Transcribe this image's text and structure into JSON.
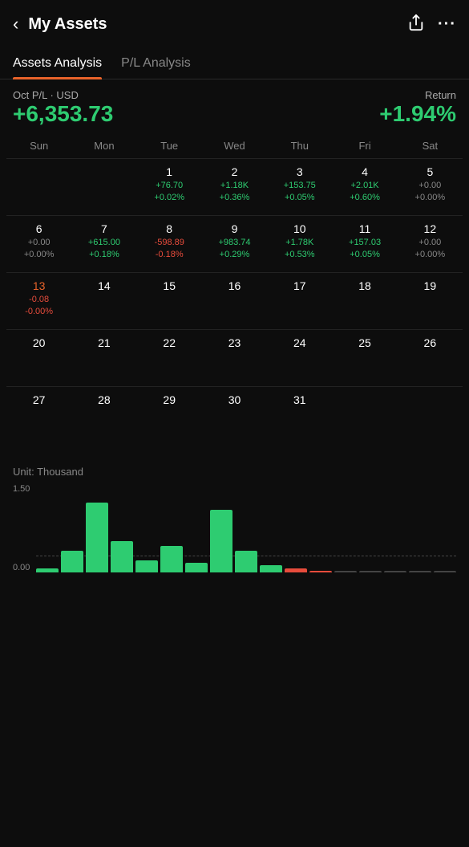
{
  "header": {
    "title": "My Assets",
    "back_icon": "‹",
    "share_icon": "⬆",
    "more_icon": "···"
  },
  "tabs": [
    {
      "label": "Assets Analysis",
      "active": true
    },
    {
      "label": "P/L Analysis",
      "active": false
    }
  ],
  "summary": {
    "period_label": "Oct P/L · USD",
    "period_value": "+6,353.73",
    "return_label": "Return",
    "return_value": "+1.94%"
  },
  "calendar": {
    "day_names": [
      "Sun",
      "Mon",
      "Tue",
      "Wed",
      "Thu",
      "Fri",
      "Sat"
    ],
    "weeks": [
      {
        "cells": [
          {
            "day": "",
            "amount": "",
            "pct": "",
            "color": "empty"
          },
          {
            "day": "",
            "amount": "",
            "pct": "",
            "color": "empty"
          },
          {
            "day": "1",
            "amount": "+76.70",
            "pct": "+0.02%",
            "color": "green"
          },
          {
            "day": "2",
            "amount": "+1.18K",
            "pct": "+0.36%",
            "color": "green"
          },
          {
            "day": "3",
            "amount": "+153.75",
            "pct": "+0.05%",
            "color": "green"
          },
          {
            "day": "4",
            "amount": "+2.01K",
            "pct": "+0.60%",
            "color": "green"
          },
          {
            "day": "5",
            "amount": "+0.00",
            "pct": "+0.00%",
            "color": "gray"
          }
        ]
      },
      {
        "cells": [
          {
            "day": "6",
            "amount": "+0.00",
            "pct": "+0.00%",
            "color": "gray"
          },
          {
            "day": "7",
            "amount": "+615.00",
            "pct": "+0.18%",
            "color": "green"
          },
          {
            "day": "8",
            "amount": "-598.89",
            "pct": "-0.18%",
            "color": "red"
          },
          {
            "day": "9",
            "amount": "+983.74",
            "pct": "+0.29%",
            "color": "green"
          },
          {
            "day": "10",
            "amount": "+1.78K",
            "pct": "+0.53%",
            "color": "green"
          },
          {
            "day": "11",
            "amount": "+157.03",
            "pct": "+0.05%",
            "color": "green"
          },
          {
            "day": "12",
            "amount": "+0.00",
            "pct": "+0.00%",
            "color": "gray"
          }
        ]
      },
      {
        "cells": [
          {
            "day": "13",
            "amount": "-0.08",
            "pct": "-0.00%",
            "color": "red",
            "today": true
          },
          {
            "day": "14",
            "amount": "",
            "pct": "",
            "color": "empty"
          },
          {
            "day": "15",
            "amount": "",
            "pct": "",
            "color": "empty"
          },
          {
            "day": "16",
            "amount": "",
            "pct": "",
            "color": "empty"
          },
          {
            "day": "17",
            "amount": "",
            "pct": "",
            "color": "empty"
          },
          {
            "day": "18",
            "amount": "",
            "pct": "",
            "color": "empty"
          },
          {
            "day": "19",
            "amount": "",
            "pct": "",
            "color": "empty"
          }
        ]
      },
      {
        "cells": [
          {
            "day": "20",
            "amount": "",
            "pct": "",
            "color": "empty"
          },
          {
            "day": "21",
            "amount": "",
            "pct": "",
            "color": "empty"
          },
          {
            "day": "22",
            "amount": "",
            "pct": "",
            "color": "empty"
          },
          {
            "day": "23",
            "amount": "",
            "pct": "",
            "color": "empty"
          },
          {
            "day": "24",
            "amount": "",
            "pct": "",
            "color": "empty"
          },
          {
            "day": "25",
            "amount": "",
            "pct": "",
            "color": "empty"
          },
          {
            "day": "26",
            "amount": "",
            "pct": "",
            "color": "empty"
          }
        ]
      },
      {
        "cells": [
          {
            "day": "27",
            "amount": "",
            "pct": "",
            "color": "empty"
          },
          {
            "day": "28",
            "amount": "",
            "pct": "",
            "color": "empty"
          },
          {
            "day": "29",
            "amount": "",
            "pct": "",
            "color": "empty"
          },
          {
            "day": "30",
            "amount": "",
            "pct": "",
            "color": "empty"
          },
          {
            "day": "31",
            "amount": "",
            "pct": "",
            "color": "empty"
          },
          {
            "day": "",
            "amount": "",
            "pct": "",
            "color": "empty"
          },
          {
            "day": "",
            "amount": "",
            "pct": "",
            "color": "empty"
          }
        ]
      }
    ]
  },
  "chart": {
    "unit_label": "Unit: Thousand",
    "y_top": "1.50",
    "y_bottom": "0.00",
    "bars": [
      {
        "value": 0.08,
        "type": "positive"
      },
      {
        "value": 0.45,
        "type": "positive"
      },
      {
        "value": 1.45,
        "type": "positive"
      },
      {
        "value": 0.65,
        "type": "positive"
      },
      {
        "value": 0.25,
        "type": "positive"
      },
      {
        "value": 0.55,
        "type": "positive"
      },
      {
        "value": 0.2,
        "type": "positive"
      },
      {
        "value": 1.3,
        "type": "positive"
      },
      {
        "value": 0.45,
        "type": "positive"
      },
      {
        "value": 0.15,
        "type": "positive"
      },
      {
        "value": 0.08,
        "type": "negative"
      },
      {
        "value": 0.03,
        "type": "negative"
      },
      {
        "value": 0.02,
        "type": "zero"
      },
      {
        "value": 0.02,
        "type": "zero"
      },
      {
        "value": 0.02,
        "type": "zero"
      },
      {
        "value": 0.02,
        "type": "zero"
      },
      {
        "value": 0.02,
        "type": "zero"
      }
    ]
  }
}
